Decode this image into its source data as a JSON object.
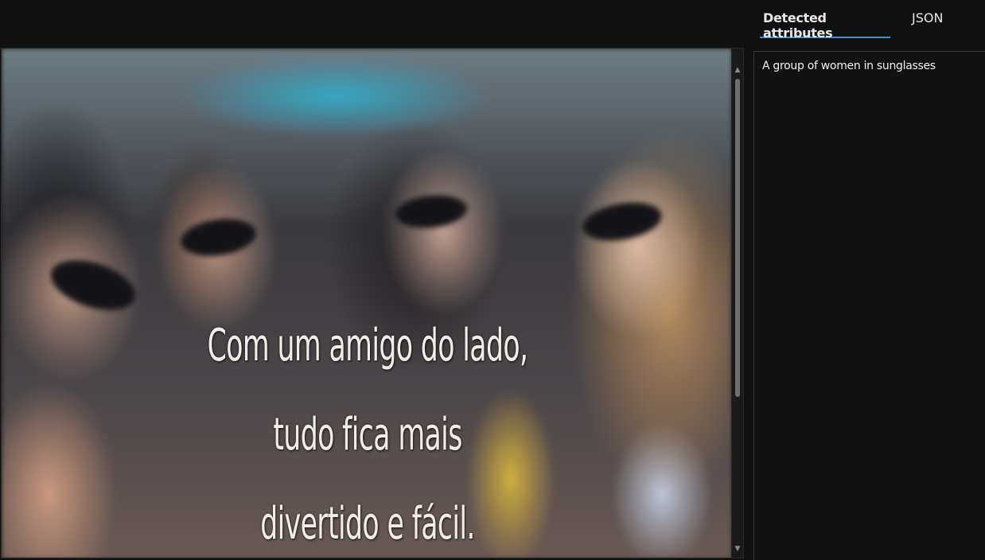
{
  "tabs": [
    {
      "label": "Detected attributes",
      "active": true
    },
    {
      "label": "JSON",
      "active": false
    }
  ],
  "image": {
    "caption_lines": [
      "Com um amigo do lado,",
      "tudo fica mais",
      "divertido e fácil."
    ]
  },
  "attributes": {
    "description": "A group of women in sunglasses"
  },
  "colors": {
    "background": "#111111",
    "tab_underline": "#3a8fe0",
    "text": "#f0f0f0"
  },
  "icons": {
    "scroll_up": "chevron-up-icon",
    "scroll_down": "chevron-down-icon"
  }
}
